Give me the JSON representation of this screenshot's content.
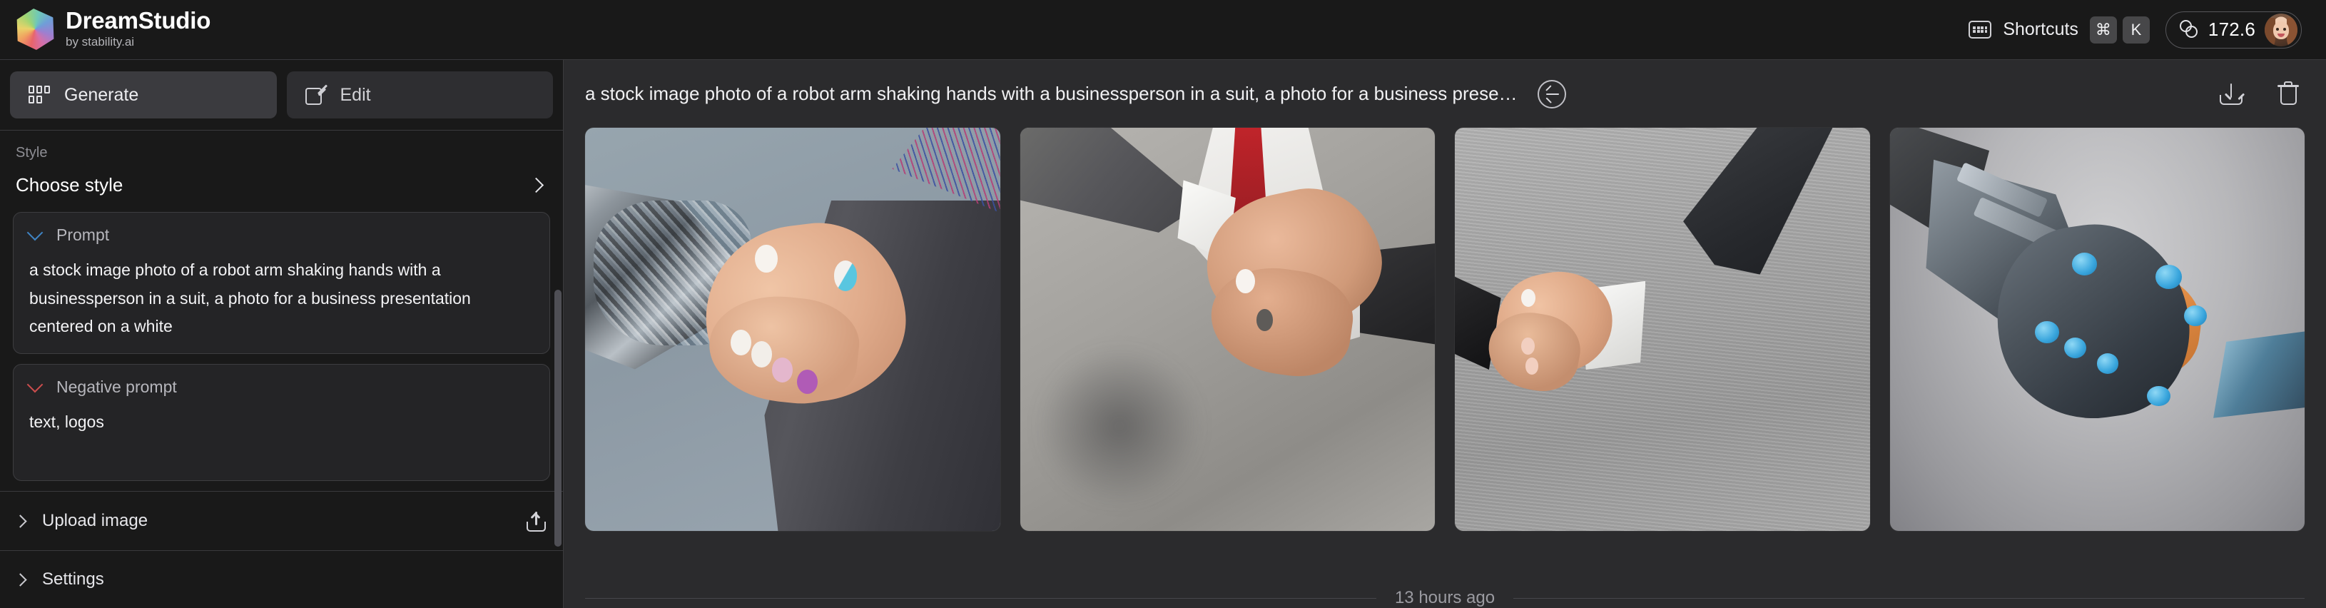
{
  "app": {
    "brand_name": "DreamStudio",
    "brand_subtitle": "by stability.ai",
    "logo_icon": "gradient-hexagon-logo"
  },
  "topbar": {
    "keyboard_icon": "keyboard-icon",
    "shortcuts_label": "Shortcuts",
    "key_modifier": "⌘",
    "key_letter": "K",
    "credits_icon": "coins-icon",
    "credits_value": "172.6",
    "avatar_icon": "user-avatar"
  },
  "sidebar": {
    "tabs": [
      {
        "label": "Generate",
        "icon": "grid-icon",
        "active": true
      },
      {
        "label": "Edit",
        "icon": "pencil-square-icon",
        "active": false
      }
    ],
    "style": {
      "label": "Style",
      "value": "Choose style",
      "chevron_icon": "chevron-right-icon"
    },
    "prompt": {
      "title": "Prompt",
      "chevron_icon": "chevron-down-icon",
      "chevron_color": "#3f84c4",
      "value": "a stock image photo of a robot arm shaking hands with a businessperson in a suit, a photo for a business presentation centered on a white"
    },
    "negative_prompt": {
      "title": "Negative prompt",
      "chevron_icon": "chevron-down-icon",
      "chevron_color": "#cc4d4d",
      "value": "text, logos"
    },
    "upload": {
      "label": "Upload image",
      "chevron_icon": "chevron-right-icon",
      "action_icon": "upload-icon"
    },
    "settings": {
      "label": "Settings",
      "chevron_icon": "chevron-right-icon"
    }
  },
  "main": {
    "generation_title": "a stock image photo of a robot arm shaking hands with a businessperson in a suit, a photo for a business prese…",
    "restore_icon": "circle-arrow-left-icon",
    "download_icon": "download-icon",
    "delete_icon": "trash-icon",
    "results": [
      {
        "alt": "robot hand shaking human hand in grey pinstripe suit on blue-grey background"
      },
      {
        "alt": "two businesspeople in suits shaking hands, red tie, light grey background"
      },
      {
        "alt": "handshake between dark suit sleeve and second hand on plain grey background"
      },
      {
        "alt": "stylized 3D robot hand with blue fingertips shaking an orange human hand"
      }
    ],
    "timestamp": "13 hours ago"
  },
  "colors": {
    "app_background": "#191919",
    "main_background": "#2b2b2d",
    "panel_background": "#242426",
    "border": "#3a3a3d",
    "active_tab": "#3b3b3f",
    "prompt_accent": "#3f84c4",
    "negative_accent": "#cc4d4d"
  }
}
